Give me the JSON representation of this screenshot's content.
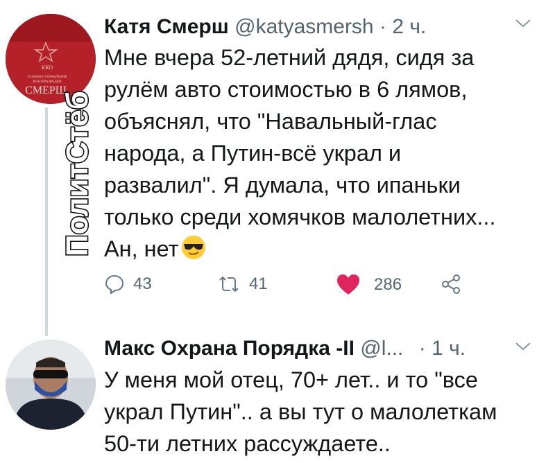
{
  "tweet1": {
    "name": "Катя Смерш",
    "handle": "@katyasmersh",
    "separator": "·",
    "time": "2 ч.",
    "text": "Мне вчера 52-летний дядя, сидя за\nрулём авто стоимостью в 6 лямов,\nобъяснял, что \"Навальный-глас\nнарода, а Путин-всё украл и\nразвалил\". Я думала, что ипаньки\nтолько среди хомячков малолетних...\nАн, нет",
    "emoji_icon": "sunglasses-emoji-icon",
    "avatar_text": [
      "ККО",
      "СМЕРШ"
    ],
    "replies": "43",
    "retweets": "41",
    "likes": "286",
    "like_color": "#e0245e"
  },
  "tweet2": {
    "name": "Макс Охрана Порядка -II",
    "handle": "@l...",
    "separator": "·",
    "time": "1 ч.",
    "text": "У меня мой отец, 70+ лет.. и то \"все\nукрал Путин\".. а вы тут о малолеткам\n50-ти летних рассуждаете.."
  },
  "watermark": {
    "text": "ПолитСтёб"
  }
}
